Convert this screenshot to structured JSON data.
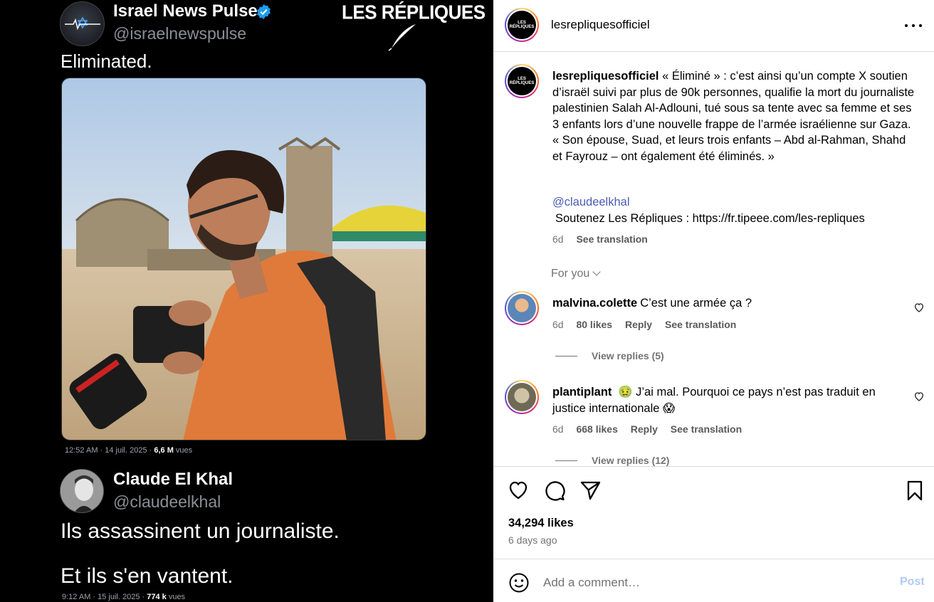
{
  "post_image": {
    "tweet1": {
      "name": "Israel News Pulse",
      "handle": "@israelnewspulse",
      "text": "Eliminated.",
      "meta_prefix": "12:52 AM · 14 juil. 2025 · ",
      "views": "6,6 M",
      "views_suffix": " vues"
    },
    "brand": "LES RÉPLIQUES",
    "tweet2": {
      "name": "Claude El Khal",
      "handle": "@claudeelkhal",
      "line1": "Ils assassinent un journaliste.",
      "line2": "Et ils s'en vantent.",
      "meta_prefix": "9:12 AM · 15 juil. 2025 · ",
      "views": "774 k",
      "views_suffix": " vues"
    }
  },
  "header": {
    "username": "lesrepliquesofficiel",
    "logo_text": "LES RÉPLIQUES"
  },
  "caption": {
    "username": "lesrepliquesofficiel",
    "text": "« Éliminé » : c’est ainsi qu’un compte X soutien d’israël suivi par plus de 90k personnes, qualifie la mort du journaliste palestinien Salah Al-Adlouni, tué sous sa tente avec sa femme et ses 3 enfants lors d’une nouvelle frappe de l’armée israélienne sur Gaza. « Son épouse, Suad, et leurs trois enfants – Abd al-Rahman, Shahd et Fayrouz – ont également été éliminés. »",
    "mention": "@claudeelkhal",
    "support": "Soutenez Les Répliques : https://fr.tipeee.com/les-repliques",
    "age": "6d",
    "see_translation": "See translation"
  },
  "for_you": "For you",
  "comments": [
    {
      "username": "malvina.colette",
      "text": "C’est une armée ça ?",
      "age": "6d",
      "likes": "80 likes",
      "reply": "Reply",
      "see_translation": "See translation",
      "view_replies": "View replies (5)"
    },
    {
      "username": "plantiplant",
      "text": "🤢 J’ai mal. Pourquoi ce pays n’est pas traduit en justice internationale 😱",
      "age": "6d",
      "likes": "668 likes",
      "reply": "Reply",
      "see_translation": "See translation",
      "view_replies": "View replies (12)"
    }
  ],
  "actions": {
    "likes": "34,294 likes",
    "time_ago": "6 days ago",
    "icons": [
      "heart-icon",
      "comment-icon",
      "share-icon",
      "bookmark-icon"
    ]
  },
  "comment_box": {
    "placeholder": "Add a comment…",
    "post_label": "Post"
  },
  "colors": {
    "link": "#4a5db5",
    "muted": "#737373",
    "post_disabled": "#b3c8f5",
    "verified": "#1d9bf0",
    "shirt": "#e07a3a"
  }
}
